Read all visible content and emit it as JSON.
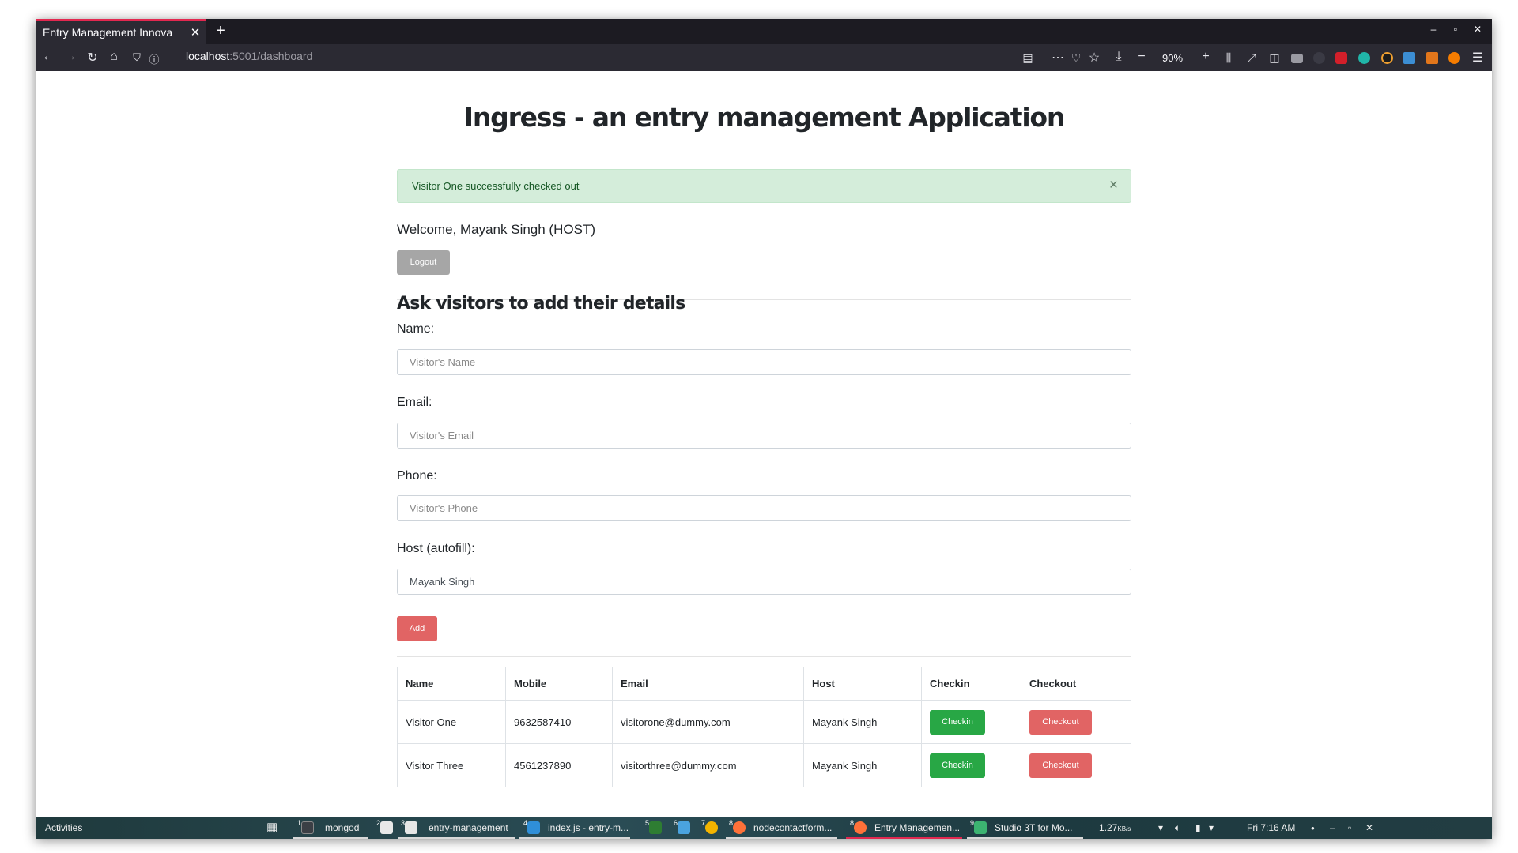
{
  "browser": {
    "tab_title": "Entry Management Innova",
    "tab_close": "✕",
    "new_tab": "+",
    "url_host": "localhost",
    "url_path": ":5001/dashboard",
    "zoom": "90%",
    "window_controls": [
      "–",
      "▫",
      "✕"
    ]
  },
  "page": {
    "title": "Ingress - an entry management Application",
    "alert": {
      "message": "Visitor One successfully checked out",
      "close": "×"
    },
    "welcome": "Welcome, Mayank Singh (HOST)",
    "logout_label": "Logout",
    "section_title": "Ask visitors to add their details",
    "form": {
      "name_label": "Name:",
      "name_placeholder": "Visitor's Name",
      "email_label": "Email:",
      "email_placeholder": "Visitor's Email",
      "phone_label": "Phone:",
      "phone_placeholder": "Visitor's Phone",
      "host_label": "Host (autofill):",
      "host_value": "Mayank Singh",
      "add_label": "Add"
    },
    "table": {
      "headers": [
        "Name",
        "Mobile",
        "Email",
        "Host",
        "Checkin",
        "Checkout"
      ],
      "rows": [
        {
          "name": "Visitor One",
          "mobile": "9632587410",
          "email": "visitorone@dummy.com",
          "host": "Mayank Singh",
          "checkin": "Checkin",
          "checkout": "Checkout"
        },
        {
          "name": "Visitor Three",
          "mobile": "4561237890",
          "email": "visitorthree@dummy.com",
          "host": "Mayank Singh",
          "checkin": "Checkin",
          "checkout": "Checkout"
        }
      ]
    }
  },
  "taskbar": {
    "activities": "Activities",
    "items": [
      {
        "num": "1",
        "label": "mongod"
      },
      {
        "num": "2",
        "label": ""
      },
      {
        "num": "3",
        "label": "entry-management"
      },
      {
        "num": "4",
        "label": "index.js - entry-m..."
      },
      {
        "num": "5",
        "label": ""
      },
      {
        "num": "6",
        "label": ""
      },
      {
        "num": "7",
        "label": ""
      },
      {
        "num": "8",
        "label": "nodecontactform..."
      },
      {
        "num": "8",
        "label": "Entry Managemen..."
      },
      {
        "num": "9",
        "label": "Studio 3T for Mo..."
      }
    ],
    "net_speed": "1.27",
    "net_unit": "KB/s",
    "clock": "Fri  7:16 AM",
    "controls": [
      "–",
      "▫",
      "✕"
    ]
  },
  "colors": {
    "alert_bg": "#d4edda",
    "success": "#28a745",
    "danger": "#e16464",
    "muted_button": "#a6a6a6",
    "firefox_tab_accent": "#e22850"
  }
}
